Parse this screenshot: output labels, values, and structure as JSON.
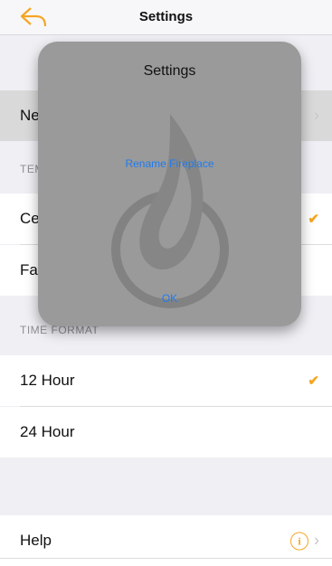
{
  "nav": {
    "title": "Settings"
  },
  "rows": {
    "name": "New",
    "temp_header": "TEMPERATURE",
    "celsius": "Celsius",
    "fahrenheit": "Fahrenheit",
    "time_header": "TIME FORMAT",
    "hour12": "12 Hour",
    "hour24": "24 Hour",
    "help": "Help"
  },
  "icons": {
    "check": "✔",
    "chevron": "›",
    "info": "i"
  },
  "modal": {
    "title": "Settings",
    "action": "Rename Fireplace",
    "ok": "OK"
  },
  "colors": {
    "accent": "#f5a623",
    "link": "#1e7cf0"
  }
}
